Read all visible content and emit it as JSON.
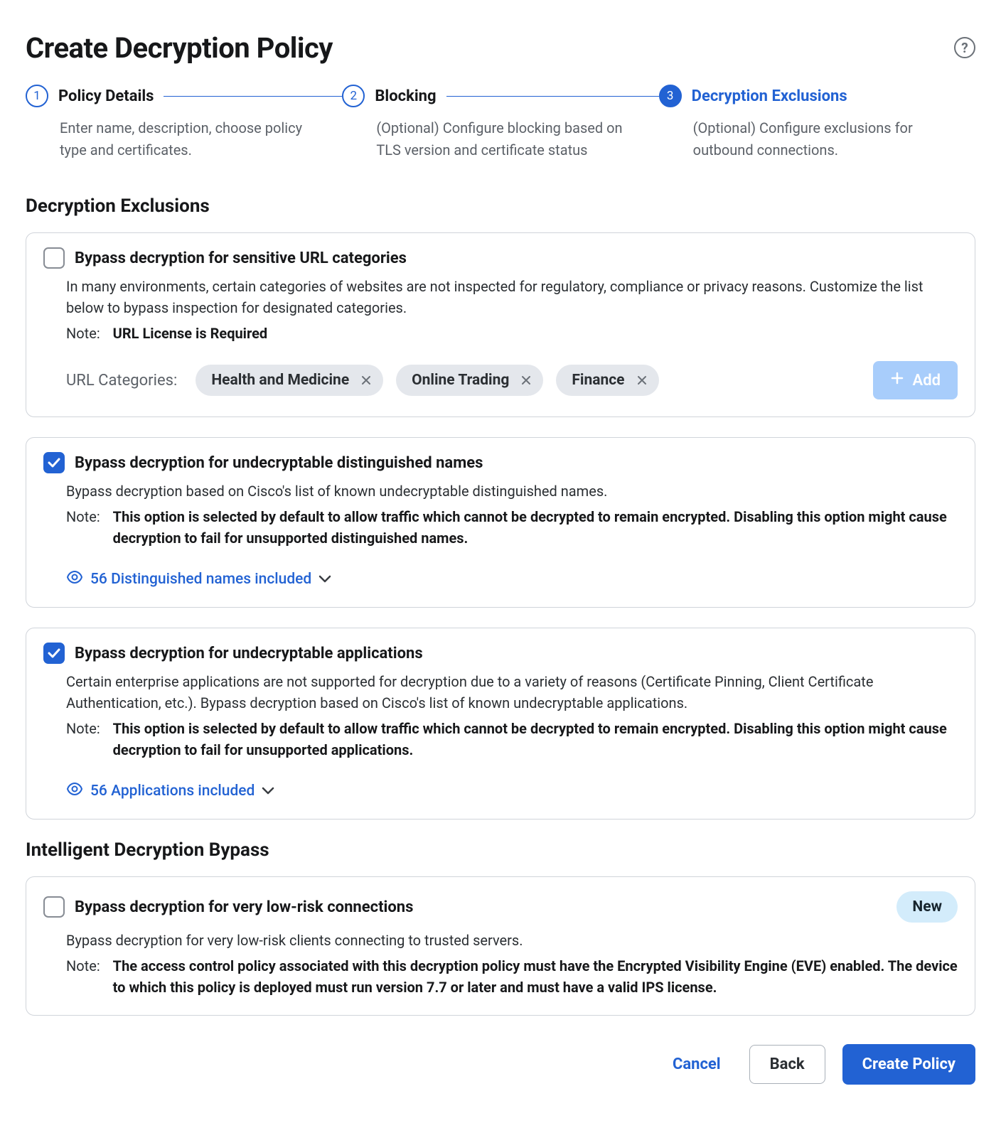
{
  "page_title": "Create Decryption Policy",
  "help_icon_glyph": "?",
  "steps": [
    {
      "num": "1",
      "title": "Policy Details",
      "desc": "Enter name, description, choose policy type and certificates."
    },
    {
      "num": "2",
      "title": "Blocking",
      "desc": "(Optional) Configure blocking based on TLS version and certificate status"
    },
    {
      "num": "3",
      "title": "Decryption Exclusions",
      "desc": "(Optional) Configure exclusions for outbound connections."
    }
  ],
  "section1_title": "Decryption Exclusions",
  "card_url": {
    "title": "Bypass decryption for sensitive URL categories",
    "desc": "In many environments, certain categories of websites are not inspected for regulatory, compliance or privacy reasons. Customize the list below to bypass inspection for designated categories.",
    "note_label": "Note:",
    "note_value": "URL License is Required",
    "cat_label": "URL Categories:",
    "chips": [
      "Health and Medicine",
      "Online Trading",
      "Finance"
    ],
    "add_label": "Add"
  },
  "card_dn": {
    "title": "Bypass decryption for undecryptable distinguished names",
    "desc": "Bypass decryption based on Cisco's list of known undecryptable distinguished names.",
    "note_label": "Note:",
    "note_value": "This option is selected by default to allow traffic which cannot be decrypted to remain encrypted. Disabling this option might cause decryption to fail for unsupported distinguished names.",
    "link": "56 Distinguished names included"
  },
  "card_apps": {
    "title": "Bypass decryption for undecryptable applications",
    "desc": "Certain enterprise applications are not supported for decryption due to a variety of reasons (Certificate Pinning, Client Certificate Authentication, etc.). Bypass decryption based on Cisco's list of known undecryptable applications.",
    "note_label": "Note:",
    "note_value": "This option is selected by default to allow traffic which cannot be decrypted to remain encrypted. Disabling this option might cause decryption to fail for unsupported applications.",
    "link": "56 Applications included"
  },
  "section2_title": "Intelligent Decryption Bypass",
  "card_lowrisk": {
    "title": "Bypass decryption for very low-risk connections",
    "badge": "New",
    "desc": "Bypass decryption for very low-risk clients connecting to trusted servers.",
    "note_label": "Note:",
    "note_value": "The access control policy associated with this decryption policy must have the Encrypted Visibility Engine (EVE) enabled. The device to which this policy is deployed must run version 7.7 or later and must have a valid IPS license."
  },
  "footer": {
    "cancel": "Cancel",
    "back": "Back",
    "create": "Create Policy"
  }
}
